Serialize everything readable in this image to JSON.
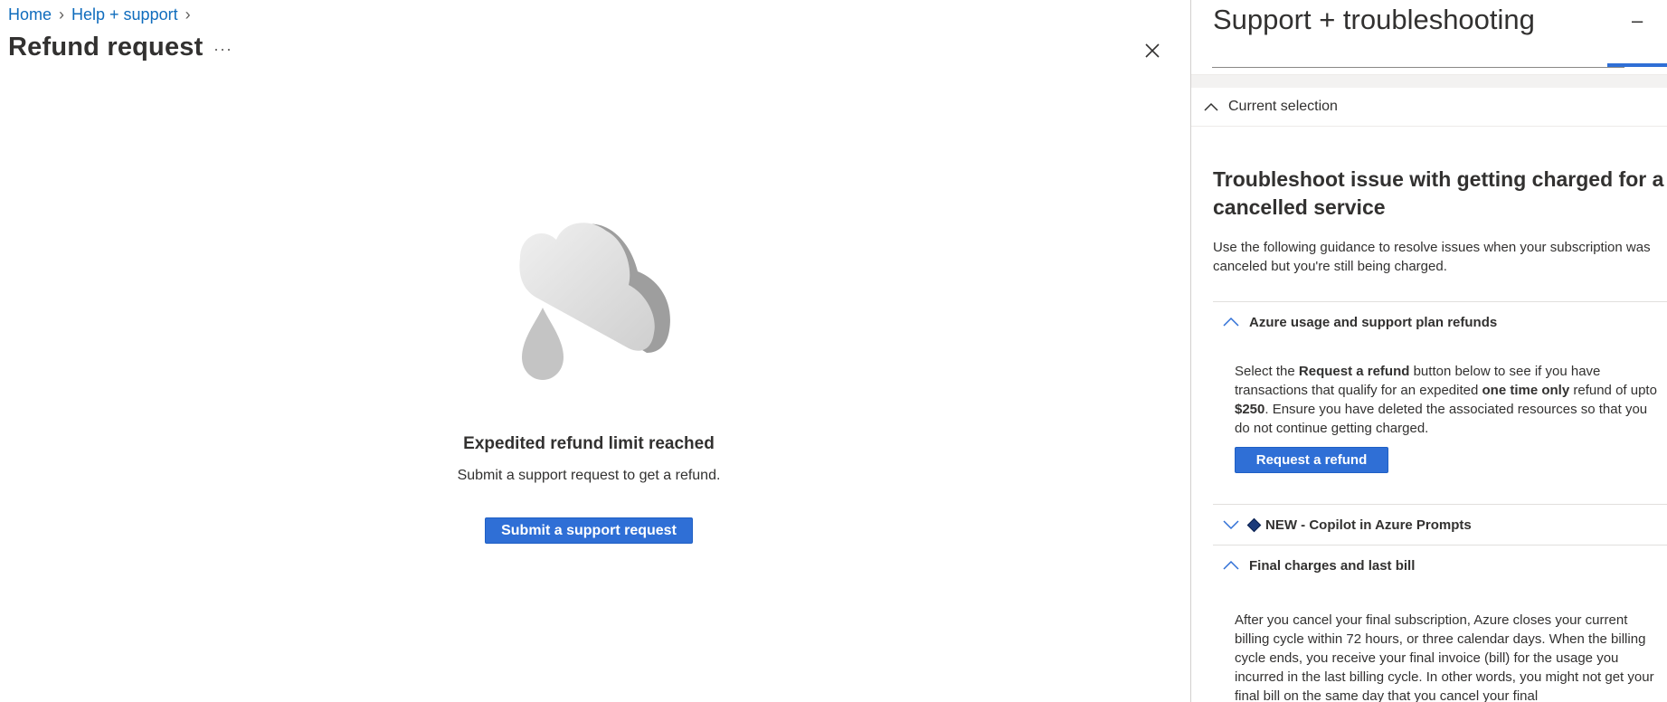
{
  "breadcrumb": {
    "items": [
      "Home",
      "Help + support"
    ]
  },
  "page": {
    "title": "Refund request",
    "more_label": "···"
  },
  "empty_state": {
    "title": "Expedited refund limit reached",
    "subtitle": "Submit a support request to get a refund.",
    "button_label": "Submit a support request"
  },
  "panel": {
    "title": "Support + troubleshooting",
    "minimize_label": "–",
    "search_value": "",
    "current_selection_label": "Current selection",
    "trouble_title": "Troubleshoot issue with getting charged for a cancelled service",
    "intro": "Use the following guidance to resolve issues when your subscription was canceled but you're still being charged.",
    "sections": [
      {
        "label": "Azure usage and support plan refunds",
        "expanded": true,
        "text_parts": {
          "p1": "Select the ",
          "b1": "Request a refund",
          "p2": " button below to see if you have transactions that qualify for an expedited ",
          "b2": "one time only",
          "p3": " refund of upto ",
          "b3": "$250",
          "p4": ". Ensure you have deleted the associated resources so that you do not continue getting charged."
        },
        "button_label": "Request a refund"
      },
      {
        "label": "NEW - Copilot in Azure Prompts",
        "expanded": false
      },
      {
        "label": "Final charges and last bill",
        "expanded": true,
        "text": "After you cancel your final subscription, Azure closes your current billing cycle within 72 hours, or three calendar days. When the billing cycle ends, you receive your final invoice (bill) for the usage you incurred in the last billing cycle. In other words, you might not get your final bill on the same day that you cancel your final"
      }
    ]
  },
  "colors": {
    "accent": "#2f6fd6",
    "link": "#0f6cbd",
    "text": "#323130"
  },
  "icons": [
    "chevron-right-icon",
    "more-icon",
    "close-icon",
    "cloud-drop-icon",
    "chevron-up-icon",
    "chevron-down-icon",
    "diamond-icon"
  ]
}
